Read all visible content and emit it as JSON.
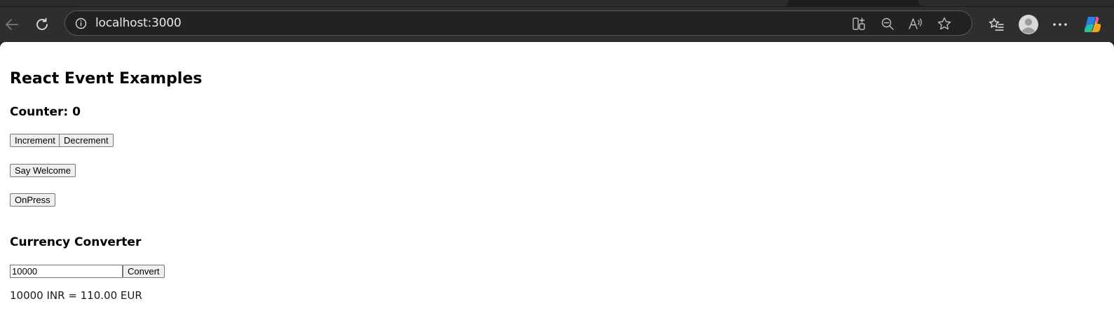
{
  "browser": {
    "url": "localhost:3000",
    "icons": {
      "back": "arrow-left-icon",
      "refresh": "refresh-icon",
      "info": "info-icon",
      "split_screen": "split-screen-icon",
      "zoom_out": "zoom-out-icon",
      "read_aloud": "read-aloud-icon",
      "favorite": "star-icon",
      "favorites": "favorites-list-icon",
      "profile": "profile-avatar-icon",
      "more": "more-dots-icon",
      "copilot": "copilot-icon"
    }
  },
  "page": {
    "title": "React Event Examples",
    "counter": {
      "heading": "Counter: 0",
      "increment_label": "Increment",
      "decrement_label": "Decrement"
    },
    "welcome_label": "Say Welcome",
    "onpress_label": "OnPress",
    "currency": {
      "heading": "Currency Converter",
      "amount_value": "10000",
      "convert_label": "Convert",
      "result": "10000 INR = 110.00 EUR"
    }
  },
  "colors": {
    "chrome_bg": "#2e2e2e",
    "address_bg": "#222222",
    "page_bg": "#ffffff",
    "button_bg": "#efefef"
  }
}
